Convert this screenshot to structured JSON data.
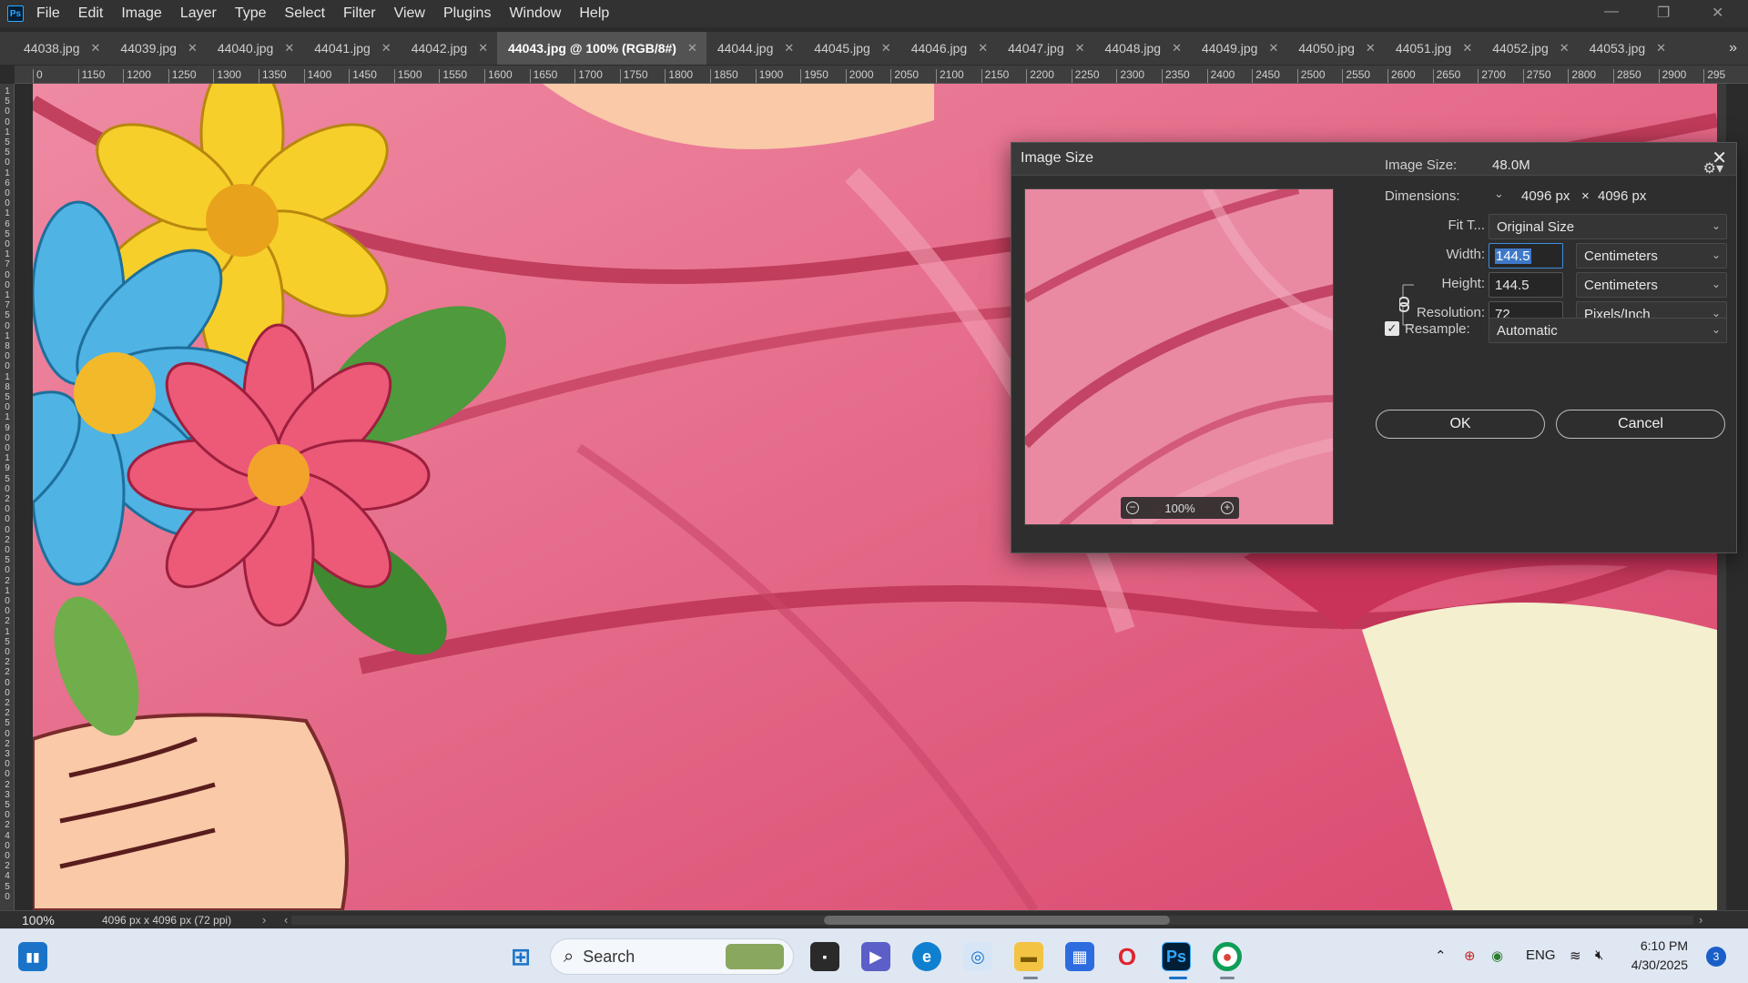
{
  "app": {
    "logo": "Ps",
    "menu": [
      "File",
      "Edit",
      "Image",
      "Layer",
      "Type",
      "Select",
      "Filter",
      "View",
      "Plugins",
      "Window",
      "Help"
    ],
    "window_controls": [
      "minimize-icon",
      "restore-icon",
      "close-icon"
    ]
  },
  "tabs": [
    {
      "label": "44038.jpg",
      "active": false
    },
    {
      "label": "44039.jpg",
      "active": false
    },
    {
      "label": "44040.jpg",
      "active": false
    },
    {
      "label": "44041.jpg",
      "active": false
    },
    {
      "label": "44042.jpg",
      "active": false
    },
    {
      "label": "44043.jpg @ 100% (RGB/8#)",
      "active": true
    },
    {
      "label": "44044.jpg",
      "active": false
    },
    {
      "label": "44045.jpg",
      "active": false
    },
    {
      "label": "44046.jpg",
      "active": false
    },
    {
      "label": "44047.jpg",
      "active": false
    },
    {
      "label": "44048.jpg",
      "active": false
    },
    {
      "label": "44049.jpg",
      "active": false
    },
    {
      "label": "44050.jpg",
      "active": false
    },
    {
      "label": "44051.jpg",
      "active": false
    },
    {
      "label": "44052.jpg",
      "active": false
    },
    {
      "label": "44053.jpg",
      "active": false
    }
  ],
  "tab_overflow": "»",
  "ruler": {
    "horizontal": [
      "0",
      "1150",
      "1200",
      "1250",
      "1300",
      "1350",
      "1400",
      "1450",
      "1500",
      "1550",
      "1600",
      "1650",
      "1700",
      "1750",
      "1800",
      "1850",
      "1900",
      "1950",
      "2000",
      "2050",
      "2100",
      "2150",
      "2200",
      "2250",
      "2300",
      "2350",
      "2400",
      "2450",
      "2500",
      "2550",
      "2600",
      "2650",
      "2700",
      "2750",
      "2800",
      "2850",
      "2900",
      "295"
    ],
    "vertical": [
      "1",
      "5",
      "0",
      "0",
      "1",
      "5",
      "5",
      "0",
      "1",
      "6",
      "0",
      "0",
      "1",
      "6",
      "5",
      "0",
      "1",
      "7",
      "0",
      "0",
      "1",
      "7",
      "5",
      "0",
      "1",
      "8",
      "0",
      "0",
      "1",
      "8",
      "5",
      "0",
      "1",
      "9",
      "0",
      "0",
      "1",
      "9",
      "5",
      "0",
      "2",
      "0",
      "0",
      "0",
      "2",
      "0",
      "5",
      "0",
      "2",
      "1",
      "0",
      "0",
      "2",
      "1",
      "5",
      "0",
      "2",
      "2",
      "0",
      "0",
      "2",
      "2",
      "5",
      "0",
      "2",
      "3",
      "0",
      "0",
      "2",
      "3",
      "5",
      "0",
      "2",
      "4",
      "0",
      "0",
      "2",
      "4",
      "5",
      "0"
    ]
  },
  "status": {
    "zoom": "100%",
    "doc_info": "4096 px x 4096 px (72 ppi)",
    "arrow_right": "›",
    "arrow_left": "‹"
  },
  "dialog": {
    "title": "Image Size",
    "close": "✕",
    "image_size_label": "Image Size:",
    "image_size_value": "48.0M",
    "dimensions_label": "Dimensions:",
    "dimensions_width": "4096 px",
    "dimensions_times": "×",
    "dimensions_height": "4096 px",
    "fit_label": "Fit T...",
    "fit_value": "Original Size",
    "width_label": "Width:",
    "width_value": "144.5",
    "width_unit": "Centimeters",
    "height_label": "Height:",
    "height_value": "144.5",
    "height_unit": "Centimeters",
    "resolution_label": "Resolution:",
    "resolution_value": "72",
    "resolution_unit": "Pixels/Inch",
    "resample_label": "Resample:",
    "resample_checked": true,
    "resample_value": "Automatic",
    "preview_zoom": "100%",
    "ok_label": "OK",
    "cancel_label": "Cancel"
  },
  "taskbar": {
    "search_label": "Search",
    "apps": [
      "windows-start-icon",
      "task-view-icon",
      "meet-icon",
      "edge-icon",
      "lens-icon",
      "file-explorer-icon",
      "store-icon",
      "opera-icon",
      "photoshop-icon",
      "chrome-icon"
    ],
    "tray": {
      "language": "ENG",
      "time": "6:10 PM",
      "date": "4/30/2025",
      "notifications": "3"
    }
  },
  "colors": {
    "accent": "#3e8ede",
    "canvas_pink": "#e86f8e",
    "flower_yellow": "#f7cf2b",
    "flower_blue": "#4fb3e3",
    "flower_pink": "#ec5a78",
    "leaf_green": "#4e9a3c",
    "skin": "#f9c9a8"
  }
}
